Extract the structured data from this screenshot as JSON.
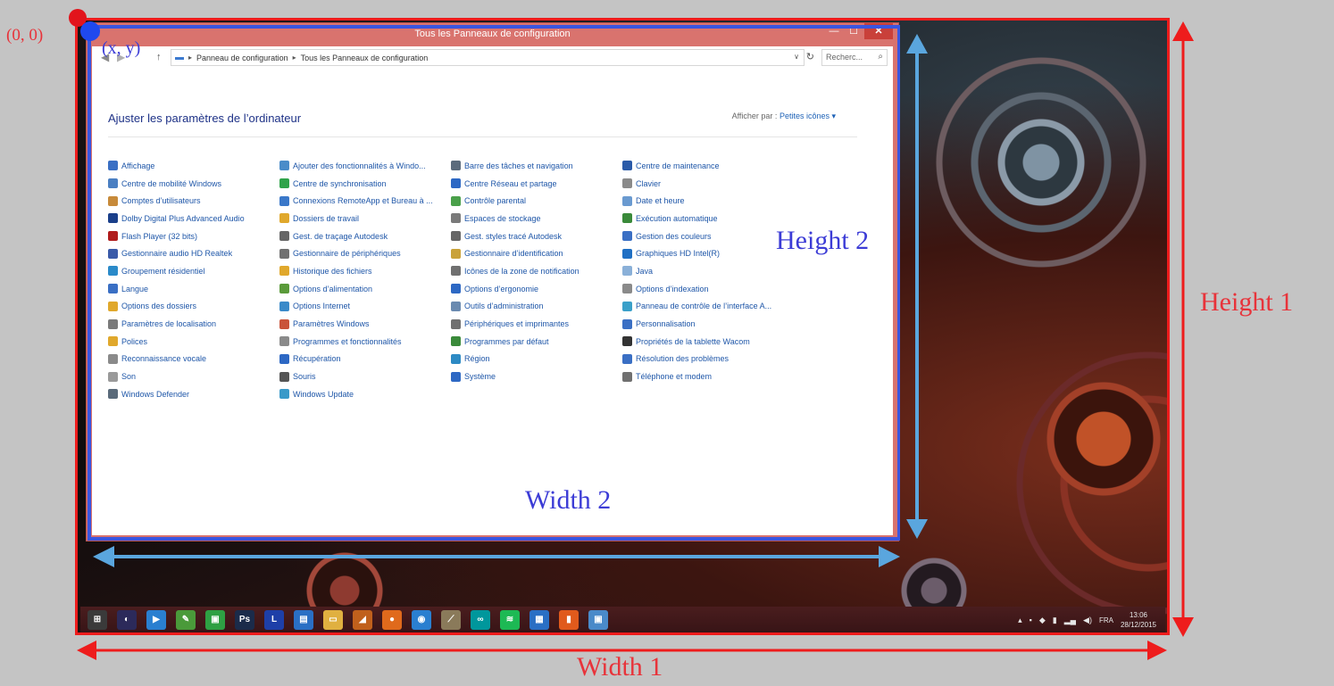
{
  "annotations": {
    "origin": "(0, 0)",
    "window_origin": "(x, y)",
    "width1": "Width 1",
    "height1": "Height 1",
    "width2": "Width 2",
    "height2": "Height 2"
  },
  "window": {
    "title": "Tous les Panneaux de configuration",
    "min_label": "—",
    "max_label": "☐",
    "close_label": "✕"
  },
  "address": {
    "crumb1": "Panneau de configuration",
    "crumb2": "Tous les Panneaux de configuration",
    "search_placeholder": "Recherc..."
  },
  "header": {
    "title": "Ajuster les paramètres de l’ordinateur",
    "view_by_label": "Afficher par :",
    "view_by_value": "Petites icônes ▾"
  },
  "items": [
    {
      "label": "Affichage",
      "icon": "display-icon",
      "color": "#3a6fc4"
    },
    {
      "label": "Ajouter des fonctionnalités à Windo...",
      "icon": "add-features-icon",
      "color": "#4a8cc9"
    },
    {
      "label": "Barre des tâches et navigation",
      "icon": "taskbar-icon",
      "color": "#5b6b7c"
    },
    {
      "label": "Centre de maintenance",
      "icon": "flag-icon",
      "color": "#2a5aa8"
    },
    {
      "label": "Centre de mobilité Windows",
      "icon": "mobility-icon",
      "color": "#4a7fc2"
    },
    {
      "label": "Centre de synchronisation",
      "icon": "sync-icon",
      "color": "#2fa34a"
    },
    {
      "label": "Centre Réseau et partage",
      "icon": "network-icon",
      "color": "#2d68c4"
    },
    {
      "label": "Clavier",
      "icon": "keyboard-icon",
      "color": "#8a8a8a"
    },
    {
      "label": "Comptes d’utilisateurs",
      "icon": "users-icon",
      "color": "#c78a3a"
    },
    {
      "label": "Connexions RemoteApp et Bureau à ...",
      "icon": "remote-icon",
      "color": "#3a78c9"
    },
    {
      "label": "Contrôle parental",
      "icon": "parental-icon",
      "color": "#4aa04a"
    },
    {
      "label": "Date et heure",
      "icon": "clock-icon",
      "color": "#6a9ad0"
    },
    {
      "label": "Dolby Digital Plus Advanced Audio",
      "icon": "dolby-icon",
      "color": "#1a3f8a"
    },
    {
      "label": "Dossiers de travail",
      "icon": "folder-icon",
      "color": "#e0a82c"
    },
    {
      "label": "Espaces de stockage",
      "icon": "storage-icon",
      "color": "#7a7a7a"
    },
    {
      "label": "Exécution automatique",
      "icon": "autoplay-icon",
      "color": "#3a8a3a"
    },
    {
      "label": "Flash Player (32 bits)",
      "icon": "flash-icon",
      "color": "#b01c1c"
    },
    {
      "label": "Gest. de traçage Autodesk",
      "icon": "plotter-icon",
      "color": "#666666"
    },
    {
      "label": "Gest. styles tracé Autodesk",
      "icon": "plot-style-icon",
      "color": "#666666"
    },
    {
      "label": "Gestion des couleurs",
      "icon": "color-icon",
      "color": "#3a6fc4"
    },
    {
      "label": "Gestionnaire audio HD Realtek",
      "icon": "realtek-icon",
      "color": "#3a5aa8"
    },
    {
      "label": "Gestionnaire de périphériques",
      "icon": "devices-icon",
      "color": "#707070"
    },
    {
      "label": "Gestionnaire d’identification",
      "icon": "credential-icon",
      "color": "#c9a23a"
    },
    {
      "label": "Graphiques HD Intel(R)",
      "icon": "intel-icon",
      "color": "#1f6fc4"
    },
    {
      "label": "Groupement résidentiel",
      "icon": "homegroup-icon",
      "color": "#2a8ac9"
    },
    {
      "label": "Historique des fichiers",
      "icon": "history-icon",
      "color": "#e0a82c"
    },
    {
      "label": "Icônes de la zone de notification",
      "icon": "tray-icon",
      "color": "#707070"
    },
    {
      "label": "Java",
      "icon": "java-icon",
      "color": "#8ab0d8"
    },
    {
      "label": "Langue",
      "icon": "language-icon",
      "color": "#3a6fc4"
    },
    {
      "label": "Options d’alimentation",
      "icon": "power-icon",
      "color": "#5a9a3a"
    },
    {
      "label": "Options d’ergonomie",
      "icon": "ergonomics-icon",
      "color": "#2d68c4"
    },
    {
      "label": "Options d’indexation",
      "icon": "index-icon",
      "color": "#8a8a8a"
    },
    {
      "label": "Options des dossiers",
      "icon": "folder-options-icon",
      "color": "#e0a82c"
    },
    {
      "label": "Options Internet",
      "icon": "internet-icon",
      "color": "#3a8ac9"
    },
    {
      "label": "Outils d’administration",
      "icon": "admin-tools-icon",
      "color": "#6a8ab0"
    },
    {
      "label": "Panneau de contrôle de l’interface A...",
      "icon": "interface-icon",
      "color": "#3aa0c9"
    },
    {
      "label": "Paramètres de localisation",
      "icon": "location-icon",
      "color": "#7a7a7a"
    },
    {
      "label": "Paramètres Windows",
      "icon": "settings-icon",
      "color": "#c9533a"
    },
    {
      "label": "Périphériques et imprimantes",
      "icon": "printer-icon",
      "color": "#707070"
    },
    {
      "label": "Personnalisation",
      "icon": "personalize-icon",
      "color": "#3a6fc4"
    },
    {
      "label": "Polices",
      "icon": "fonts-icon",
      "color": "#e0a82c"
    },
    {
      "label": "Programmes et fonctionnalités",
      "icon": "programs-icon",
      "color": "#8a8a8a"
    },
    {
      "label": "Programmes par défaut",
      "icon": "default-programs-icon",
      "color": "#3a8a3a"
    },
    {
      "label": "Propriétés de la tablette Wacom",
      "icon": "wacom-icon",
      "color": "#333333"
    },
    {
      "label": "Reconnaissance vocale",
      "icon": "microphone-icon",
      "color": "#8a8a8a"
    },
    {
      "label": "Récupération",
      "icon": "recovery-icon",
      "color": "#2d68c4"
    },
    {
      "label": "Région",
      "icon": "region-icon",
      "color": "#2d8ac4"
    },
    {
      "label": "Résolution des problèmes",
      "icon": "troubleshoot-icon",
      "color": "#3a6fc4"
    },
    {
      "label": "Son",
      "icon": "speaker-icon",
      "color": "#9a9a9a"
    },
    {
      "label": "Souris",
      "icon": "mouse-icon",
      "color": "#555555"
    },
    {
      "label": "Système",
      "icon": "system-icon",
      "color": "#2d68c4"
    },
    {
      "label": "Téléphone et modem",
      "icon": "phone-icon",
      "color": "#707070"
    },
    {
      "label": "Windows Defender",
      "icon": "defender-icon",
      "color": "#5a6a7a"
    },
    {
      "label": "Windows Update",
      "icon": "update-icon",
      "color": "#3a9ac9"
    }
  ],
  "taskbar": {
    "apps": [
      {
        "name": "start-icon",
        "glyph": "⊞",
        "color": "#3a3a3a"
      },
      {
        "name": "eclipse-icon",
        "glyph": "◐",
        "color": "#2c2a5a"
      },
      {
        "name": "media-player-icon",
        "glyph": "▶",
        "color": "#2a7fd0"
      },
      {
        "name": "notepad-icon",
        "glyph": "✎",
        "color": "#4a9a3a"
      },
      {
        "name": "store-icon",
        "glyph": "▣",
        "color": "#2ea043"
      },
      {
        "name": "photoshop-icon",
        "glyph": "Ps",
        "color": "#1b2b4a"
      },
      {
        "name": "launcher-icon",
        "glyph": "L",
        "color": "#1e3fa8"
      },
      {
        "name": "settings-app-icon",
        "glyph": "▤",
        "color": "#2a6fc4"
      },
      {
        "name": "file-explorer-icon",
        "glyph": "▭",
        "color": "#e0b040"
      },
      {
        "name": "matlab-icon",
        "glyph": "◢",
        "color": "#c0601c"
      },
      {
        "name": "firefox-icon",
        "glyph": "●",
        "color": "#e06a1c"
      },
      {
        "name": "chrome-icon",
        "glyph": "◉",
        "color": "#2a7fd0"
      },
      {
        "name": "tool-icon",
        "glyph": "⟋",
        "color": "#8a7a5a"
      },
      {
        "name": "arduino-icon",
        "glyph": "∞",
        "color": "#00979c"
      },
      {
        "name": "spotify-icon",
        "glyph": "≋",
        "color": "#1db954"
      },
      {
        "name": "document-icon",
        "glyph": "▦",
        "color": "#2a6fc4"
      },
      {
        "name": "office-icon",
        "glyph": "▮",
        "color": "#e05a1c"
      },
      {
        "name": "control-panel-icon",
        "glyph": "▣",
        "color": "#4a8ac9"
      }
    ],
    "language": "FRA",
    "time": "13:06",
    "date": "28/12/2015"
  }
}
